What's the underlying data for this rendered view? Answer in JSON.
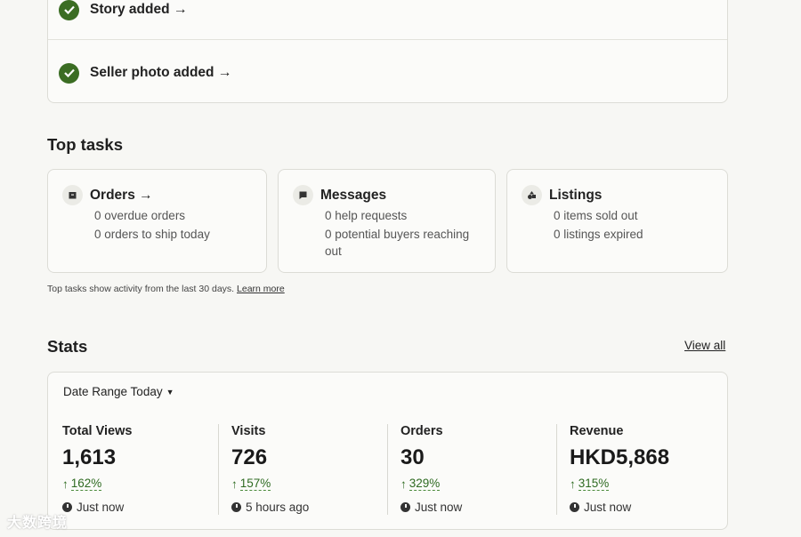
{
  "checklist": {
    "items": [
      {
        "label": "Story added",
        "arrow": "→"
      },
      {
        "label": "Seller photo added",
        "arrow": "→"
      }
    ]
  },
  "top_tasks": {
    "title": "Top tasks",
    "cards": [
      {
        "title": "Orders →",
        "icon": "box-icon",
        "lines": [
          "0 overdue orders",
          "0 orders to ship today"
        ]
      },
      {
        "title": "Messages",
        "icon": "chat-icon",
        "lines": [
          "0 help requests",
          "0 potential buyers reaching",
          "out"
        ]
      },
      {
        "title": "Listings",
        "icon": "shapes-icon",
        "lines": [
          "0 items sold out",
          "0 listings expired"
        ]
      }
    ],
    "footnote": "Top tasks show activity from the last 30 days.",
    "learn_more": "Learn more"
  },
  "stats": {
    "title": "Stats",
    "view_all": "View all",
    "date_range": "Date Range Today",
    "items": [
      {
        "label": "Total Views",
        "value": "1,613",
        "change": "162%",
        "time": "Just now"
      },
      {
        "label": "Visits",
        "value": "726",
        "change": "157%",
        "time": "5 hours ago"
      },
      {
        "label": "Orders",
        "value": "30",
        "change": "329%",
        "time": "Just now"
      },
      {
        "label": "Revenue",
        "value": "HKD5,868",
        "change": "315%",
        "time": "Just now"
      }
    ]
  },
  "colors": {
    "accent_green": "#3b6d23",
    "change_green": "#2f6b22"
  },
  "watermark": "大数跨境"
}
